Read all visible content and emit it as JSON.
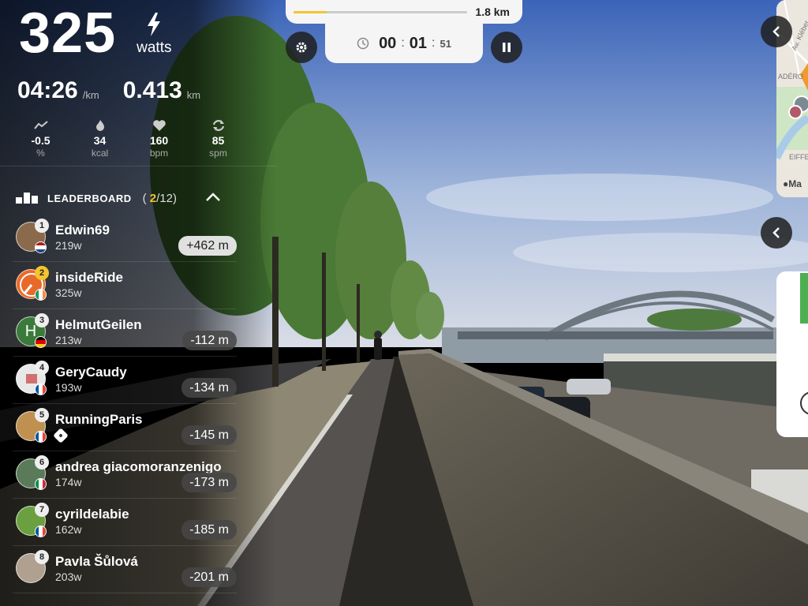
{
  "metrics": {
    "power": "325",
    "power_unit": "watts",
    "pace": "04:26",
    "pace_unit": "/km",
    "distance": "0.413",
    "distance_unit": "km"
  },
  "stats": [
    {
      "icon": "slope-icon",
      "value": "-0.5",
      "unit": "%"
    },
    {
      "icon": "flame-icon",
      "value": "34",
      "unit": "kcal"
    },
    {
      "icon": "heart-icon",
      "value": "160",
      "unit": "bpm"
    },
    {
      "icon": "cadence-icon",
      "value": "85",
      "unit": "spm"
    }
  ],
  "leaderboard": {
    "title": "LEADERBOARD",
    "position": "2",
    "total": "/12",
    "rows": [
      {
        "rank": "1",
        "name": "Edwin69",
        "watts": "219w",
        "gap": "+462 m",
        "lead": true,
        "avatar_color": "#8a6a4a",
        "flag": "nl"
      },
      {
        "rank": "2",
        "name": "insideRide",
        "watts": "325w",
        "gap": "",
        "lead": false,
        "avatar_color": "#e86a2a",
        "flag": "ie"
      },
      {
        "rank": "3",
        "name": "HelmutGeilen",
        "watts": "213w",
        "gap": "-112 m",
        "lead": false,
        "avatar_color": "#3a7a3a",
        "avatar_letter": "H",
        "flag": "de"
      },
      {
        "rank": "4",
        "name": "GeryCaudy",
        "watts": "193w",
        "gap": "-134 m",
        "lead": false,
        "avatar_color": "#e8e8e8",
        "flag": "fr"
      },
      {
        "rank": "5",
        "name": "RunningParis",
        "watts": "",
        "gap": "-145 m",
        "lead": false,
        "avatar_color": "#c09050",
        "flag": "fr"
      },
      {
        "rank": "6",
        "name": "andrea giacomoranzenigo",
        "watts": "174w",
        "gap": "-173 m",
        "lead": false,
        "avatar_color": "#5a7a5a",
        "flag": "it"
      },
      {
        "rank": "7",
        "name": "cyrildelabie",
        "watts": "162w",
        "gap": "-185 m",
        "lead": false,
        "avatar_color": "#6aa040",
        "flag": "fr"
      },
      {
        "rank": "8",
        "name": "Pavla Šůlová",
        "watts": "203w",
        "gap": "-201 m",
        "lead": false,
        "avatar_color": "#b0a090",
        "flag": ""
      }
    ]
  },
  "route": {
    "total_distance": "1.8 km",
    "progress_fraction": 0.19
  },
  "timer": {
    "hours": "00",
    "minutes": "01",
    "seconds": "51"
  },
  "map": {
    "street_label": "Av. Kléber",
    "area_label": "ADÉRO",
    "landmark_label": "EIFFE",
    "attribution": "Ma"
  },
  "colors": {
    "accent": "#f4c430",
    "panel_bg": "#f5f5f5"
  }
}
